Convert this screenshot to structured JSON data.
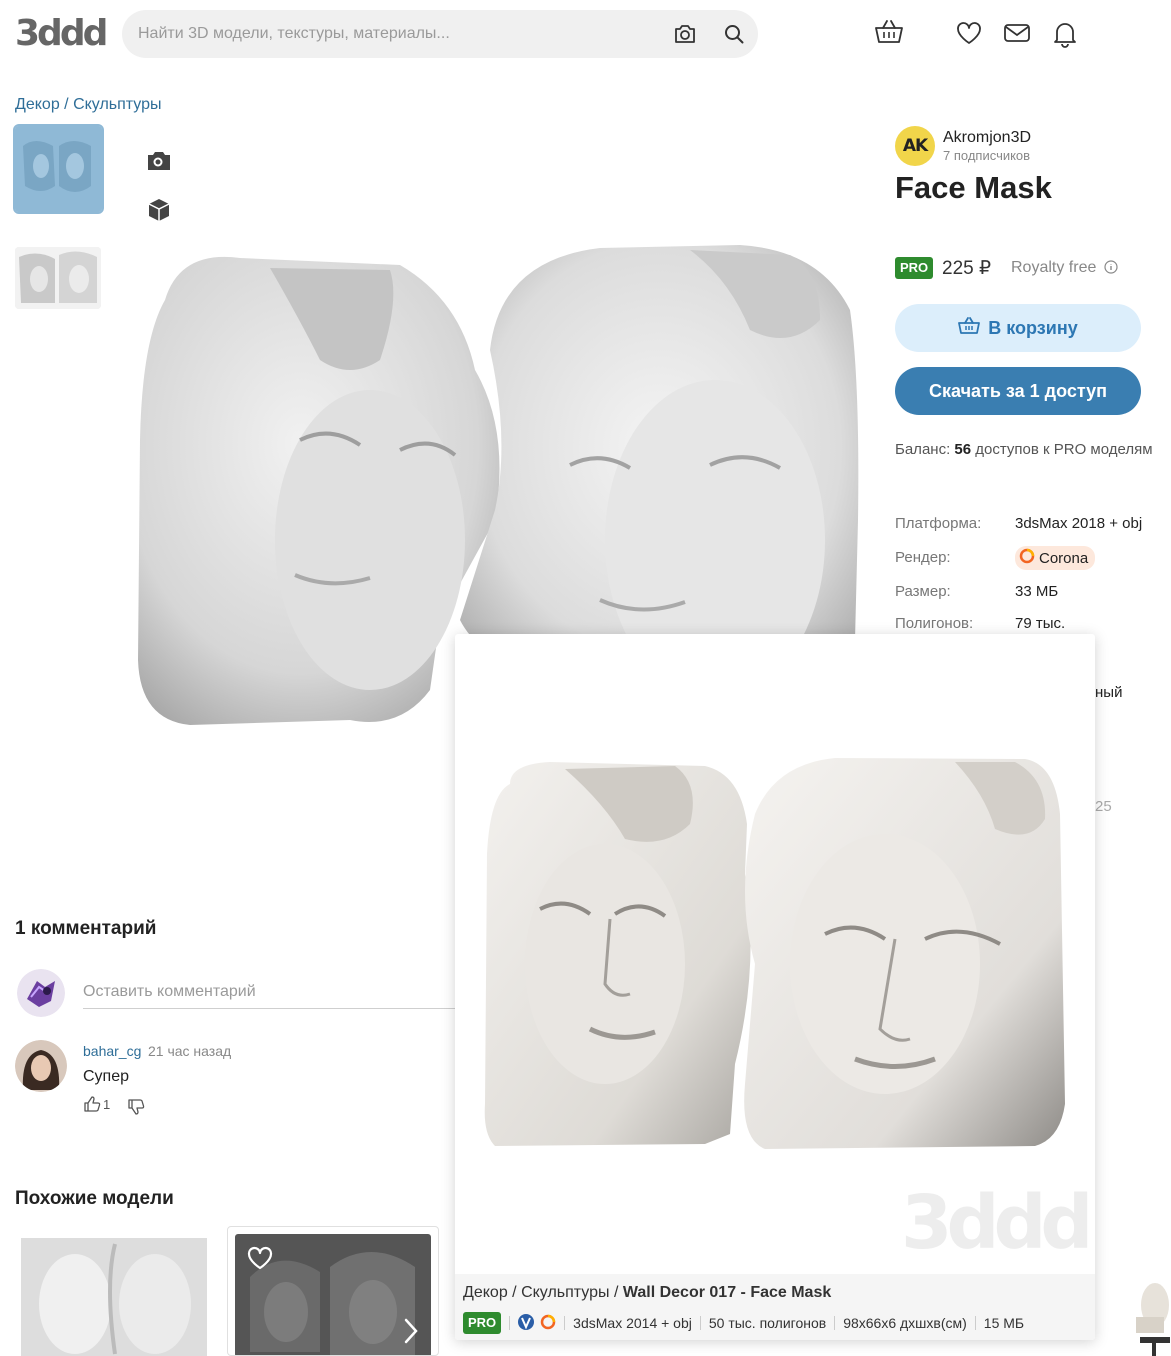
{
  "header": {
    "logo_text": "3ddd",
    "search_placeholder": "Найти 3D модели, текстуры, материалы..."
  },
  "breadcrumb": {
    "category": "Декор",
    "separator": " / ",
    "subcategory": "Скульптуры"
  },
  "author": {
    "avatar_text": "AK",
    "name": "Akromjon3D",
    "subscribers": "7 подписчиков"
  },
  "product": {
    "title": "Face Mask",
    "badge": "PRO",
    "price": "225 ₽",
    "license": "Royalty free",
    "cart_label": "В корзину",
    "download_label": "Скачать за 1 доступ",
    "balance_prefix": "Баланс: ",
    "balance_count": "56",
    "balance_suffix": " доступов к PRO моделям"
  },
  "specs": [
    {
      "key": "Платформа:",
      "value": "3dsMax 2018 + obj"
    },
    {
      "key": "Рендер:",
      "value": "Corona"
    },
    {
      "key": "Размер:",
      "value": "33 МБ"
    },
    {
      "key": "Полигонов:",
      "value": "79 тыс."
    }
  ],
  "obscured_fragments": {
    "line1": "ный",
    "line2": "25"
  },
  "comments": {
    "heading": "1 комментарий",
    "input_placeholder": "Оставить комментарий",
    "items": [
      {
        "author": "bahar_cg",
        "time": "21 час назад",
        "text": "Супер",
        "likes": "1"
      }
    ]
  },
  "similar": {
    "heading": "Похожие модели"
  },
  "popup": {
    "crumb_category": "Декор",
    "crumb_sub": "Скульптуры",
    "crumb_sep": " / ",
    "model_name": "Wall Decor 017 - Face Mask",
    "badge": "PRO",
    "platform": "3dsMax 2014 + obj",
    "polygons": "50 тыс. полигонов",
    "dims": "98x66x6 дхшхв(см)",
    "size": "15 МБ",
    "watermark": "3ddd"
  },
  "colors": {
    "accent": "#3a7eb1",
    "link": "#2f6e98",
    "pro_green": "#2e8b2e",
    "cart_bg": "#dceefb"
  }
}
